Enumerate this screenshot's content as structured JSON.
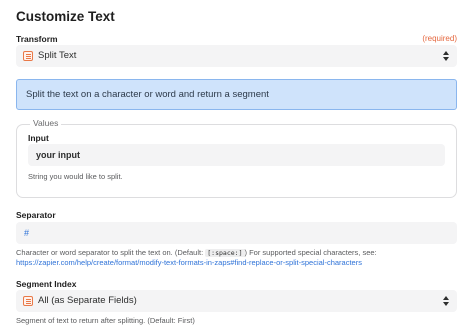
{
  "title": "Customize Text",
  "transform": {
    "label": "Transform",
    "required": "(required)",
    "selected": "Split Text"
  },
  "info_banner": "Split the text on a character or word and return a segment",
  "values": {
    "legend": "Values",
    "input_label": "Input",
    "input_value": "your input",
    "input_help": "String you would like to split."
  },
  "separator": {
    "label": "Separator",
    "value": "#",
    "help_prefix": "Character or word separator to split the text on. (Default: ",
    "help_code": "[:space:]",
    "help_suffix": ") For supported special characters, see:",
    "help_link": "https://zapier.com/help/create/format/modify-text-formats-in-zaps#find-replace-or-split-special-characters"
  },
  "segment_index": {
    "label": "Segment Index",
    "selected": "All (as Separate Fields)",
    "help": "Segment of text to return after splitting. (Default: First)"
  },
  "colors": {
    "accent_required": "#e5673e",
    "info_bg": "#cfe3fb",
    "info_border": "#8ab6ee",
    "link": "#2f73d8"
  }
}
